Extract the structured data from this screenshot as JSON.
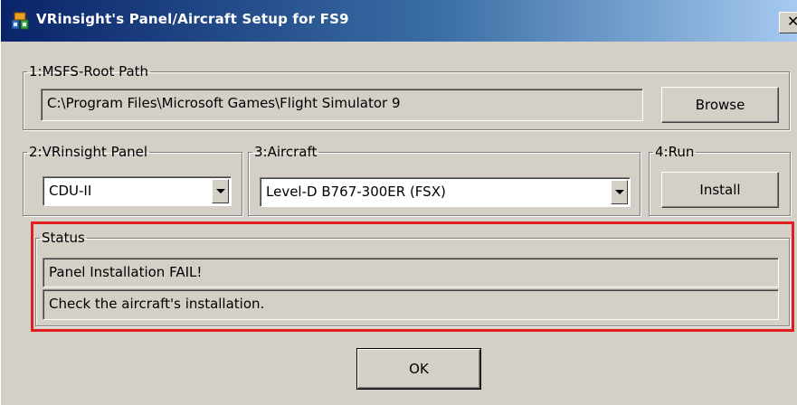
{
  "window": {
    "title": "VRinsight's Panel/Aircraft Setup for FS9",
    "close_glyph": "✕",
    "icon": "app-icon"
  },
  "msfs_group": {
    "legend": "1:MSFS-Root Path",
    "path_value": "C:\\Program Files\\Microsoft Games\\Flight Simulator 9",
    "browse_label": "Browse"
  },
  "panel_group": {
    "legend": "2:VRinsight Panel",
    "selected": "CDU-II"
  },
  "aircraft_group": {
    "legend": "3:Aircraft",
    "selected": "Level-D B767-300ER (FSX)"
  },
  "run_group": {
    "legend": "4:Run",
    "install_label": "Install"
  },
  "status_group": {
    "legend": "Status",
    "line1": "Panel Installation FAIL!",
    "line2": "Check the aircraft's installation."
  },
  "ok_label": "OK",
  "colors": {
    "titlebar_start": "#0a246a",
    "titlebar_end": "#a6caf0",
    "highlight": "#e02020",
    "window_bg": "#d4d0c8"
  }
}
